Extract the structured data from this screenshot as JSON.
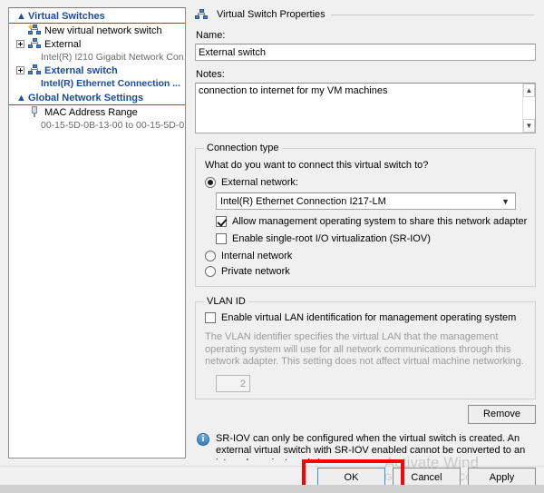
{
  "tree": {
    "groups": [
      {
        "label": "Virtual Switches",
        "chevron": "collapse-chevron-icon",
        "items": [
          {
            "icon": "new-virtual-switch-icon",
            "label": "New virtual network switch",
            "expander": false,
            "sub": null,
            "selected": false
          },
          {
            "icon": "virtual-switch-icon",
            "label": "External",
            "expander": true,
            "sub": "Intel(R) I210 Gigabit Network Con...",
            "selected": false
          },
          {
            "icon": "virtual-switch-icon",
            "label": "External switch",
            "expander": true,
            "sub": "Intel(R) Ethernet Connection ...",
            "selected": true
          }
        ]
      },
      {
        "label": "Global Network Settings",
        "chevron": "collapse-chevron-icon",
        "items": [
          {
            "icon": "mac-address-icon",
            "label": "MAC Address Range",
            "expander": false,
            "sub": "00-15-5D-0B-13-00 to 00-15-5D-0...",
            "selected": false
          }
        ]
      }
    ]
  },
  "properties": {
    "section_title": "Virtual Switch Properties",
    "section_icon": "virtual-switch-icon",
    "name_label": "Name:",
    "name_value": "External switch",
    "notes_label": "Notes:",
    "notes_value": "connection to internet for my VM machines",
    "notes_scroll_up": "scroll-up-arrow-icon",
    "notes_scroll_down": "scroll-down-arrow-icon"
  },
  "connection_type": {
    "legend": "Connection type",
    "question": "What do you want to connect this virtual switch to?",
    "options": [
      {
        "label": "External network:",
        "selected": true
      },
      {
        "label": "Internal network",
        "selected": false
      },
      {
        "label": "Private network",
        "selected": false
      }
    ],
    "adapter_value": "Intel(R) Ethernet Connection I217-LM",
    "adapter_caret": "chevron-down-icon",
    "checkboxes": [
      {
        "label": "Allow management operating system to share this network adapter",
        "checked": true
      },
      {
        "label": "Enable single-root I/O virtualization (SR-IOV)",
        "checked": false
      }
    ]
  },
  "vlan": {
    "legend": "VLAN ID",
    "checkbox_label": "Enable virtual LAN identification for management operating system",
    "checkbox_checked": false,
    "help_text": "The VLAN identifier specifies the virtual LAN that the management operating system will use for all network communications through this network adapter. This setting does not affect virtual machine networking.",
    "id_value": "2"
  },
  "remove_button": "Remove",
  "info_note": {
    "icon": "info-icon",
    "text": "SR-IOV can only be configured when the virtual switch is created. An external virtual switch with SR-IOV enabled cannot be converted to an internal or private switch."
  },
  "buttons": {
    "ok": "OK",
    "cancel": "Cancel",
    "apply": "Apply"
  },
  "watermark": {
    "line1": "Activate Wind",
    "line2": "Go to System in Co"
  },
  "colors": {
    "accent": "#1b4b9c",
    "highlight_box": "#ff0000",
    "window_bg": "#f0f0f0"
  }
}
